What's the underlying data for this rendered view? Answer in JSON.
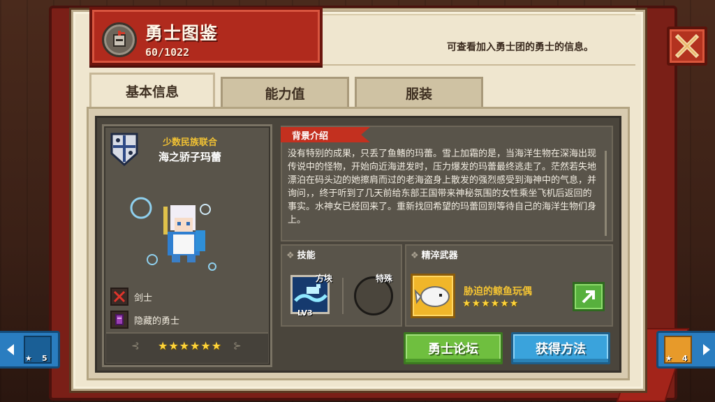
{
  "header": {
    "title": "勇士图鉴",
    "count": "60/1022",
    "hint": "可查看加入勇士团的勇士的信息。"
  },
  "tabs": [
    {
      "label": "基本信息",
      "active": true
    },
    {
      "label": "能力值",
      "active": false
    },
    {
      "label": "服装",
      "active": false
    }
  ],
  "hero": {
    "faction": "少数民族联合",
    "name": "海之骄子玛蕾",
    "class_label": "剑士",
    "hidden_label": "隐藏的勇士",
    "stars": "★★★★★★",
    "rarity": 6
  },
  "story": {
    "header": "背景介绍",
    "text": "没有特别的成果，只丢了鱼鳍的玛蕾。雪上加霜的是，当海洋生物在深海出现传说中的怪物，开始向近海进发时，压力爆发的玛蕾最终逃走了。茫然若失地漂泊在码头边的她擦肩而过的老海盗身上散发的强烈感受到海神中的气息，并询问，，终于听到了几天前给东部王国带来神秘氛围的女性乘坐飞机后返回的事实。水神女已经回来了。重新找回希望的玛蕾回到等待自己的海洋生物们身上。"
  },
  "skills": {
    "header": "技能",
    "block_label": "方块",
    "block_level": "LV3",
    "special_label": "特殊"
  },
  "weapon": {
    "header": "精淬武器",
    "name": "胁迫的鲸鱼玩偶",
    "stars": "★★★★★★",
    "rarity": 6
  },
  "buttons": {
    "forum": "勇士论坛",
    "obtain": "获得方法"
  },
  "nav": {
    "prev_count": "5",
    "next_count": "4"
  },
  "icons": {
    "title": "knight-helmet-icon",
    "close": "close-x-icon",
    "class": "sword-icon",
    "hidden": "scroll-icon",
    "weapon_link": "arrow-upright-icon"
  },
  "colors": {
    "title_plate": "#b02a1d",
    "page": "#efe6cf",
    "panel": "#59544a",
    "star": "#ffd43b",
    "forum_button": "#6fbf3f",
    "obtain_button": "#3aa3dc"
  }
}
